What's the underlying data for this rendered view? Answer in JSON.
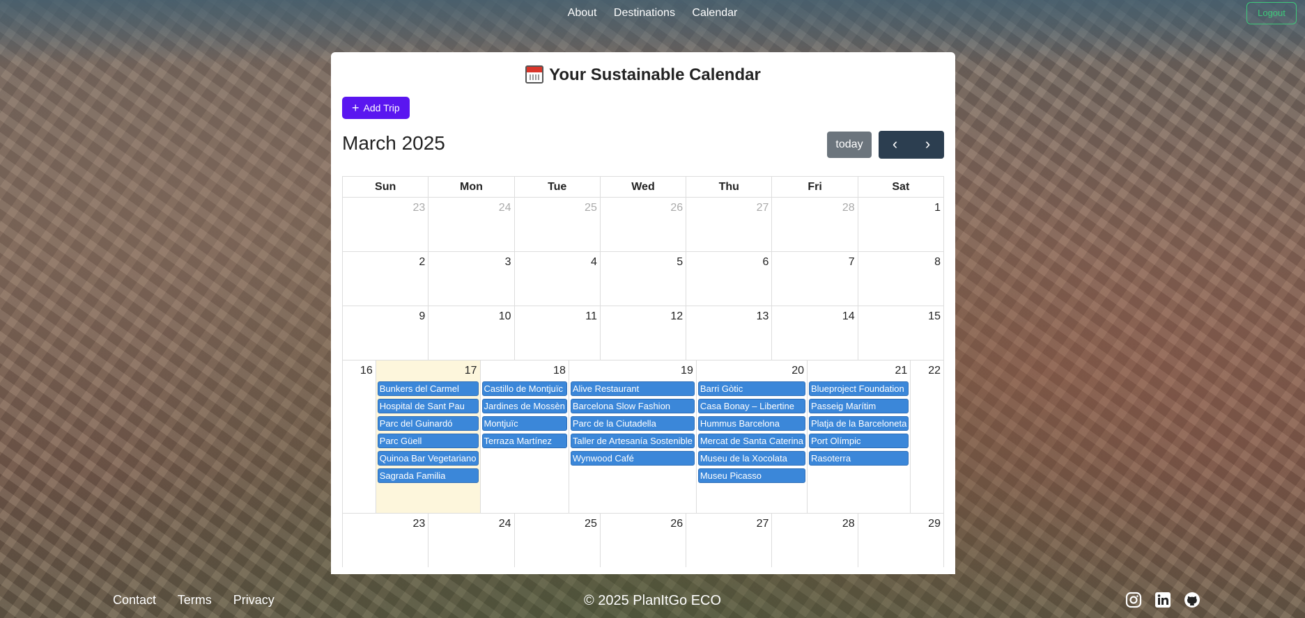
{
  "nav": {
    "links": [
      "About",
      "Destinations",
      "Calendar"
    ],
    "logout": "Logout"
  },
  "calendar": {
    "title": "Your Sustainable Calendar",
    "add_trip": "Add Trip",
    "month": "March 2025",
    "today_btn": "today",
    "weekdays": [
      "Sun",
      "Mon",
      "Tue",
      "Wed",
      "Thu",
      "Fri",
      "Sat"
    ],
    "weeks": [
      [
        {
          "n": "23",
          "other": true
        },
        {
          "n": "24",
          "other": true
        },
        {
          "n": "25",
          "other": true
        },
        {
          "n": "26",
          "other": true
        },
        {
          "n": "27",
          "other": true
        },
        {
          "n": "28",
          "other": true
        },
        {
          "n": "1"
        }
      ],
      [
        {
          "n": "2"
        },
        {
          "n": "3"
        },
        {
          "n": "4"
        },
        {
          "n": "5"
        },
        {
          "n": "6"
        },
        {
          "n": "7"
        },
        {
          "n": "8"
        }
      ],
      [
        {
          "n": "9"
        },
        {
          "n": "10"
        },
        {
          "n": "11"
        },
        {
          "n": "12"
        },
        {
          "n": "13"
        },
        {
          "n": "14"
        },
        {
          "n": "15"
        }
      ],
      [
        {
          "n": "16"
        },
        {
          "n": "17",
          "today": true,
          "events": [
            "Bunkers del Carmel",
            "Hospital de Sant Pau",
            "Parc del Guinardó",
            "Parc Güell",
            "Quinoa Bar Vegetariano",
            "Sagrada Familia"
          ]
        },
        {
          "n": "18",
          "events": [
            "Castillo de Montjuïc",
            "Jardines de Mossèn",
            "Montjuïc",
            "Terraza Martínez"
          ]
        },
        {
          "n": "19",
          "events": [
            "Alive Restaurant",
            "Barcelona Slow Fashion",
            "Parc de la Ciutadella",
            "Taller de Artesanía Sostenible",
            "Wynwood Café"
          ]
        },
        {
          "n": "20",
          "events": [
            "Barri Gòtic",
            "Casa Bonay – Libertine",
            "Hummus Barcelona",
            "Mercat de Santa Caterina",
            "Museu de la Xocolata",
            "Museu Picasso"
          ]
        },
        {
          "n": "21",
          "events": [
            "Blueproject Foundation",
            "Passeig Marítim",
            "Platja de la Barceloneta",
            "Port Olímpic",
            "Rasoterra"
          ]
        },
        {
          "n": "22"
        }
      ],
      [
        {
          "n": "23"
        },
        {
          "n": "24"
        },
        {
          "n": "25"
        },
        {
          "n": "26"
        },
        {
          "n": "27"
        },
        {
          "n": "28"
        },
        {
          "n": "29"
        }
      ]
    ],
    "event_color": "#3b87d9",
    "today_bg": "#fdf6dc"
  },
  "footer": {
    "links": [
      "Contact",
      "Terms",
      "Privacy"
    ],
    "copyright": "© 2025 PlanItGo ECO",
    "socials": [
      "instagram-icon",
      "linkedin-icon",
      "github-icon"
    ]
  }
}
